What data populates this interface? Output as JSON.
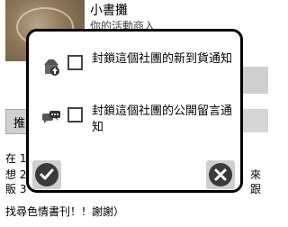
{
  "background": {
    "shop_title": "小書攤",
    "shop_subtitle": "你的活動商入",
    "left_button_label": "推",
    "description_lines": {
      "l1": "在 1",
      "l2": "想 2",
      "l3": "販 3",
      "l4": "找尋色情書刊！！謝謝）"
    },
    "desc_right": {
      "r2": "來",
      "r3": "跟"
    }
  },
  "dialog": {
    "options": [
      {
        "icon": "store-upload-icon",
        "label": "封鎖這個社團的新到貨通知"
      },
      {
        "icon": "chat-bubbles-icon",
        "label": "封鎖這個社團的公開留言通知"
      }
    ],
    "confirm_icon": "checkmark-icon",
    "close_icon": "close-icon"
  }
}
